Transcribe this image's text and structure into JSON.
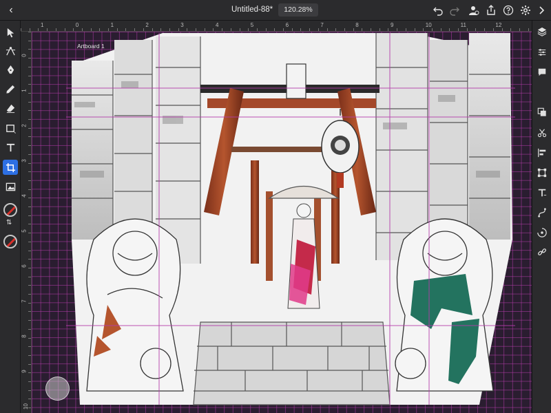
{
  "header": {
    "title": "Untitled-88*",
    "zoom": "120.28%"
  },
  "artboard": {
    "label": "Artboard 1"
  },
  "ruler": {
    "top_labels": [
      "1",
      "0",
      "1",
      "2",
      "3",
      "4",
      "5",
      "6",
      "7",
      "8",
      "9",
      "10",
      "11",
      "12"
    ],
    "left_labels": [
      "0",
      "1",
      "2",
      "3",
      "4",
      "5",
      "6",
      "7",
      "8",
      "9",
      "10"
    ]
  },
  "toolbar": {
    "tools": [
      "select-tool",
      "node-tool",
      "pen-tool",
      "pencil-tool",
      "eraser-tool",
      "shape-tool",
      "type-tool",
      "crop-tool",
      "image-tool"
    ],
    "active_tool": "crop-tool"
  },
  "colors": {
    "accent": "#2d6fe3",
    "grid": "#b43caa",
    "stroke_swatch": "#d7302a"
  }
}
